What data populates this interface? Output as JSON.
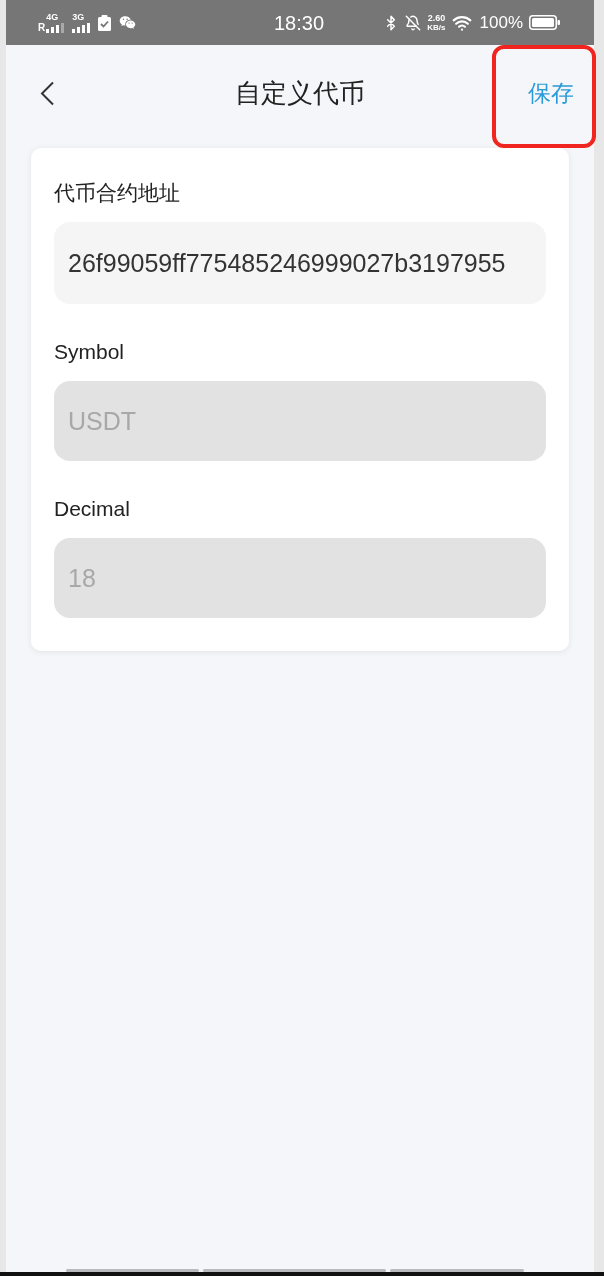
{
  "status_bar": {
    "network_primary": "4G",
    "roaming": "R",
    "network_secondary": "3G",
    "time": "18:30",
    "speed_value": "2.60",
    "speed_unit": "KB/s",
    "battery": "100%"
  },
  "header": {
    "title": "自定义代币",
    "save": {
      "label": "保存",
      "highlighted": true
    }
  },
  "fields": [
    {
      "label": "代币合约地址",
      "value": "26f99059ff775485246999027b3197955",
      "disabled": false
    },
    {
      "label": "Symbol",
      "value": "USDT",
      "disabled": true
    },
    {
      "label": "Decimal",
      "value": "18",
      "disabled": true
    }
  ]
}
